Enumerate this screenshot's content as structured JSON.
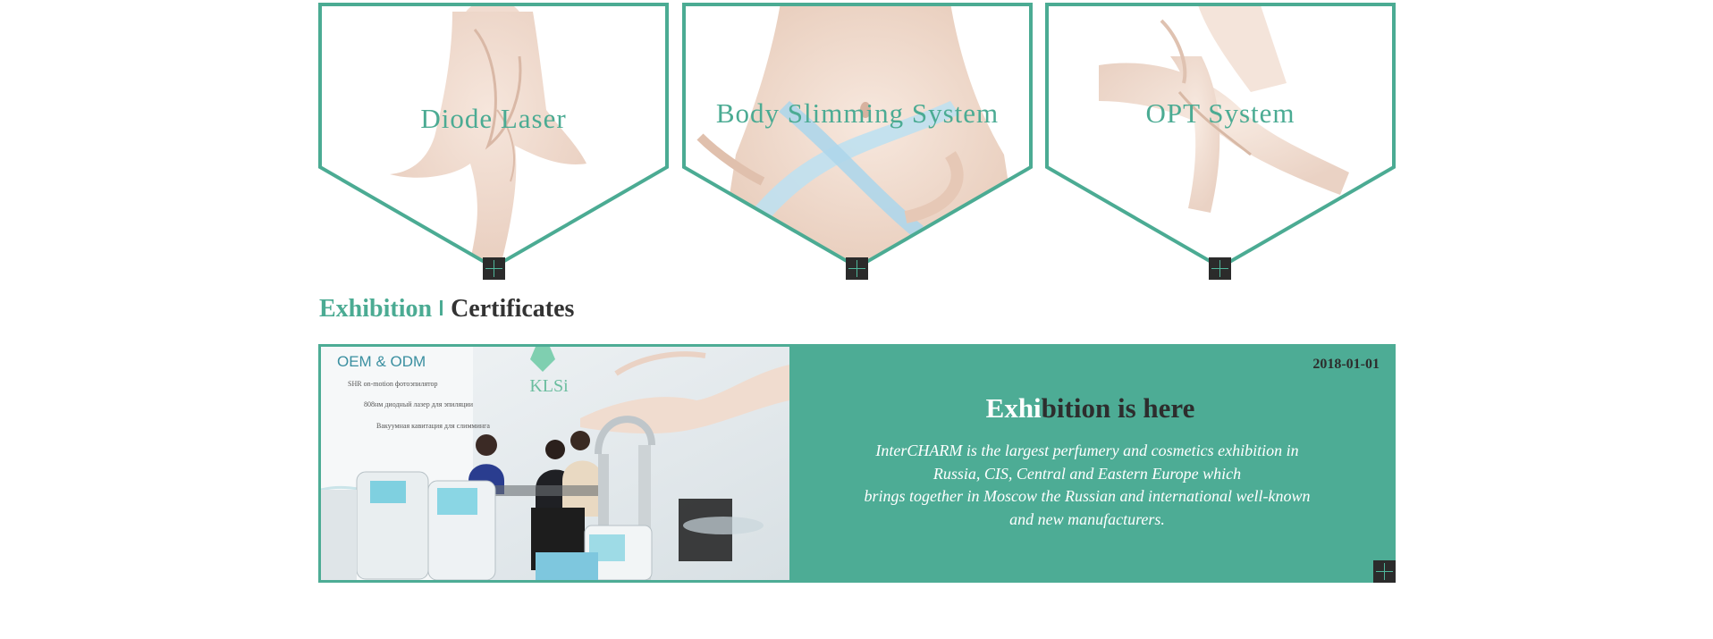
{
  "products": [
    {
      "title": "Diode Laser",
      "more_icon": "plus-icon"
    },
    {
      "title": "Body Slimming System",
      "more_icon": "plus-icon"
    },
    {
      "title": "OPT System",
      "more_icon": "plus-icon"
    }
  ],
  "section": {
    "tab_active": "Exhibition",
    "tab_other": "Certificates"
  },
  "news": {
    "date": "2018-01-01",
    "headline_highlight": "Exhi",
    "headline_rest": "bition is here",
    "description_lines": [
      "InterCHARM is the largest perfumery and cosmetics exhibition in",
      "Russia, CIS, Central and Eastern Europe which",
      "brings together in Moscow the Russian and international well-known",
      "and new manufacturers."
    ],
    "photo": {
      "sign_title": "OEM & ODM",
      "brand": "KLSi",
      "sign_lines": [
        "SHR on-motion фотоэпилятор",
        "808нм диодный лазер для эпиляции",
        "Вакуумная кавитация для слимминга"
      ]
    },
    "more_icon": "plus-icon"
  },
  "colors": {
    "accent": "#4bab93",
    "banner_bg": "#4dac95",
    "dark": "#2d2d2d",
    "button_bg": "#2b2b2b"
  }
}
